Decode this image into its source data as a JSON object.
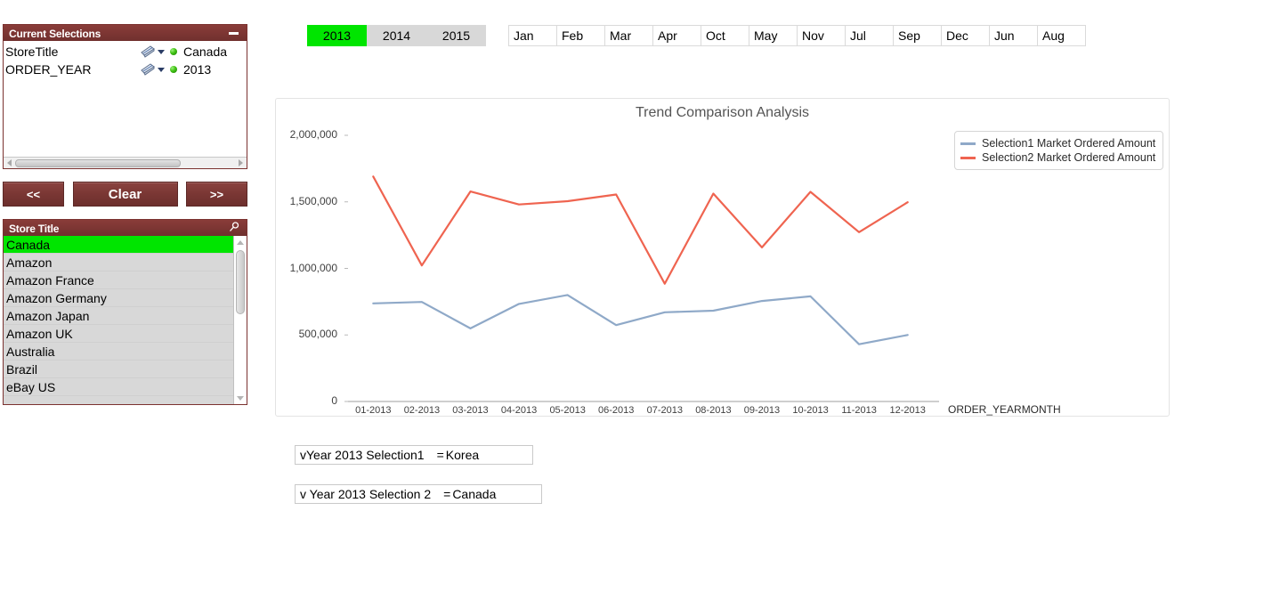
{
  "current_selections": {
    "title": "Current Selections",
    "minimize_icon": "minimize-icon",
    "rows": [
      {
        "field": "StoreTitle",
        "clear_icon": "eraser-icon",
        "dropdown_icon": "chevron-down-icon",
        "state_icon": "green-dot",
        "value": "Canada"
      },
      {
        "field": "ORDER_YEAR",
        "clear_icon": "eraser-icon",
        "dropdown_icon": "chevron-down-icon",
        "state_icon": "green-dot",
        "value": "2013"
      }
    ]
  },
  "nav_buttons": {
    "back_label": "<<",
    "clear_label": "Clear",
    "forward_label": ">>"
  },
  "store_title_box": {
    "title": "Store Title",
    "search_icon": "search-icon",
    "items": [
      {
        "label": "Canada",
        "selected": true
      },
      {
        "label": "Amazon",
        "selected": false
      },
      {
        "label": "Amazon France",
        "selected": false
      },
      {
        "label": "Amazon Germany",
        "selected": false
      },
      {
        "label": "Amazon Japan",
        "selected": false
      },
      {
        "label": "Amazon UK",
        "selected": false
      },
      {
        "label": "Australia",
        "selected": false
      },
      {
        "label": "Brazil",
        "selected": false
      },
      {
        "label": "eBay US",
        "selected": false
      }
    ]
  },
  "year_filter": {
    "options": [
      {
        "label": "2013",
        "selected": true
      },
      {
        "label": "2014",
        "selected": false
      },
      {
        "label": "2015",
        "selected": false
      }
    ]
  },
  "month_filter": {
    "options": [
      {
        "label": "Jan"
      },
      {
        "label": "Feb"
      },
      {
        "label": "Mar"
      },
      {
        "label": "Apr"
      },
      {
        "label": "Oct"
      },
      {
        "label": "May"
      },
      {
        "label": "Nov"
      },
      {
        "label": "Jul"
      },
      {
        "label": "Sep"
      },
      {
        "label": "Dec"
      },
      {
        "label": "Jun"
      },
      {
        "label": "Aug"
      }
    ]
  },
  "variables": [
    {
      "name": "vYear 2013 Selection1",
      "equals": "=",
      "value": "Korea"
    },
    {
      "name": "v Year 2013 Selection 2",
      "equals": "=",
      "value": "Canada"
    }
  ],
  "colors": {
    "panel_header": "#7b3230",
    "selected_green": "#00e500",
    "series1": "#8fa9c8",
    "series2": "#ef6450"
  },
  "chart_data": {
    "type": "line",
    "title": "Trend Comparison Analysis",
    "xlabel": "ORDER_YEARMONTH",
    "ylabel": "",
    "ylim": [
      0,
      2000000
    ],
    "yticks": [
      0,
      500000,
      1000000,
      1500000,
      2000000
    ],
    "ytick_labels": [
      "0",
      "500,000",
      "1,000,000",
      "1,500,000",
      "2,000,000"
    ],
    "grid": false,
    "legend_position": "top-right",
    "categories": [
      "01-2013",
      "02-2013",
      "03-2013",
      "04-2013",
      "05-2013",
      "06-2013",
      "07-2013",
      "08-2013",
      "09-2013",
      "10-2013",
      "11-2013",
      "12-2013"
    ],
    "series": [
      {
        "name": "Selection1 Market Ordered Amount",
        "color": "#8fa9c8",
        "values": [
          737000,
          748000,
          549000,
          733000,
          800000,
          574000,
          670000,
          682000,
          755000,
          790000,
          430000,
          500000
        ]
      },
      {
        "name": "Selection2 Market Ordered Amount",
        "color": "#ef6450",
        "values": [
          1690000,
          1022000,
          1578000,
          1480000,
          1505000,
          1555000,
          885000,
          1562000,
          1158000,
          1575000,
          1272000,
          1497000
        ]
      }
    ]
  }
}
